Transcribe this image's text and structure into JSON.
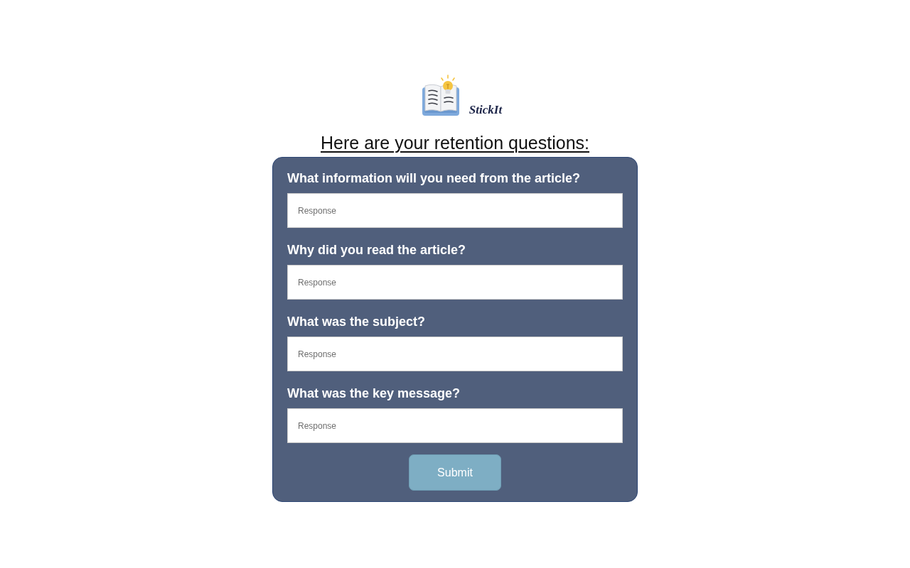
{
  "logo": {
    "name": "StickIt"
  },
  "heading": "Here are your retention questions:",
  "questions": [
    {
      "label": "What information will you need from the article?",
      "placeholder": "Response"
    },
    {
      "label": "Why did you read the article?",
      "placeholder": "Response"
    },
    {
      "label": "What was the subject?",
      "placeholder": "Response"
    },
    {
      "label": "What was the key message?",
      "placeholder": "Response"
    }
  ],
  "submit_button": "Submit"
}
